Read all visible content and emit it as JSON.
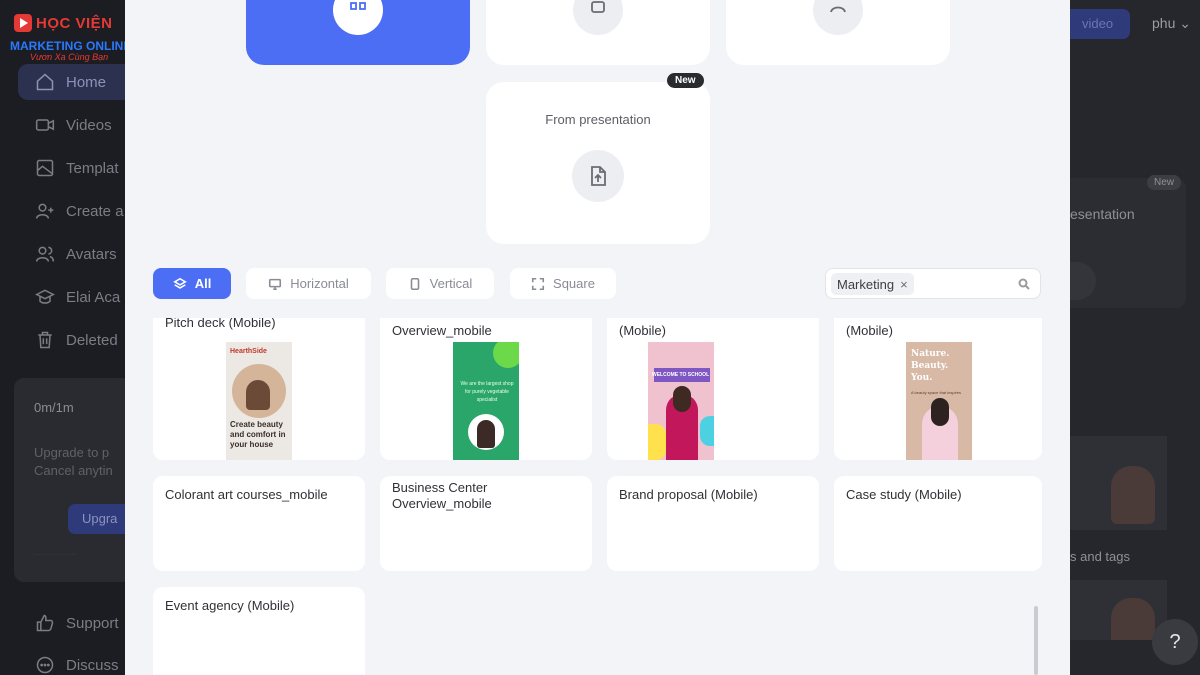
{
  "logo": {
    "line1": "HỌC VIỆN",
    "line2": "MARKETING ONLINE",
    "line3": "Vươn Xa Cùng Bạn"
  },
  "sidebar": {
    "items": [
      {
        "label": "Home",
        "icon": "home-icon"
      },
      {
        "label": "Videos",
        "icon": "video-icon"
      },
      {
        "label": "Templat",
        "icon": "template-icon"
      },
      {
        "label": "Create a",
        "icon": "create-avatar-icon"
      },
      {
        "label": "Avatars",
        "icon": "avatars-icon"
      },
      {
        "label": "Elai Aca",
        "icon": "academy-icon"
      },
      {
        "label": "Deleted",
        "icon": "trash-icon"
      },
      {
        "label": "Support",
        "icon": "support-icon"
      },
      {
        "label": "Discuss",
        "icon": "discuss-icon"
      }
    ],
    "plan": {
      "usage": "0m/1m",
      "desc1": "Upgrade to p",
      "desc2": "Cancel anytin",
      "button": "Upgra"
    }
  },
  "right_panel": {
    "video_button": "video",
    "user": "phu",
    "new_badge": "New",
    "presentation_label": "esentation",
    "tags_label": "s and tags"
  },
  "modal": {
    "options": {
      "presentation_title": "From presentation",
      "new_badge": "New"
    },
    "filters": {
      "all": "All",
      "horizontal": "Horizontal",
      "vertical": "Vertical",
      "square": "Square"
    },
    "search": {
      "chip": "Marketing",
      "chip_remove": "×"
    },
    "templates": [
      {
        "title": "Pitch deck (Mobile)"
      },
      {
        "title": "Overview_mobile"
      },
      {
        "title": "(Mobile)"
      },
      {
        "title": "(Mobile)"
      },
      {
        "title": "Colorant art courses_mobile"
      },
      {
        "title": "Business Center Overview_mobile"
      },
      {
        "title": "Brand proposal (Mobile)"
      },
      {
        "title": "Case study (Mobile)"
      },
      {
        "title": "Event agency (Mobile)"
      }
    ],
    "thumb_text": {
      "hearthside_brand": "HearthSide",
      "hearthside_copy": "Create beauty and comfort in your house",
      "green_copy": "We are the largest shop for purely vegetable specialist",
      "school_copy": "WELCOME TO SCHOOL",
      "nature_copy": "Nature. Beauty. You.",
      "nature_sub": "A beauty space that inspires"
    }
  },
  "help": "?",
  "colors": {
    "accent": "#4c6ef5",
    "modal_bg": "#f2f4f8",
    "dark_bg": "#1e1f24"
  }
}
